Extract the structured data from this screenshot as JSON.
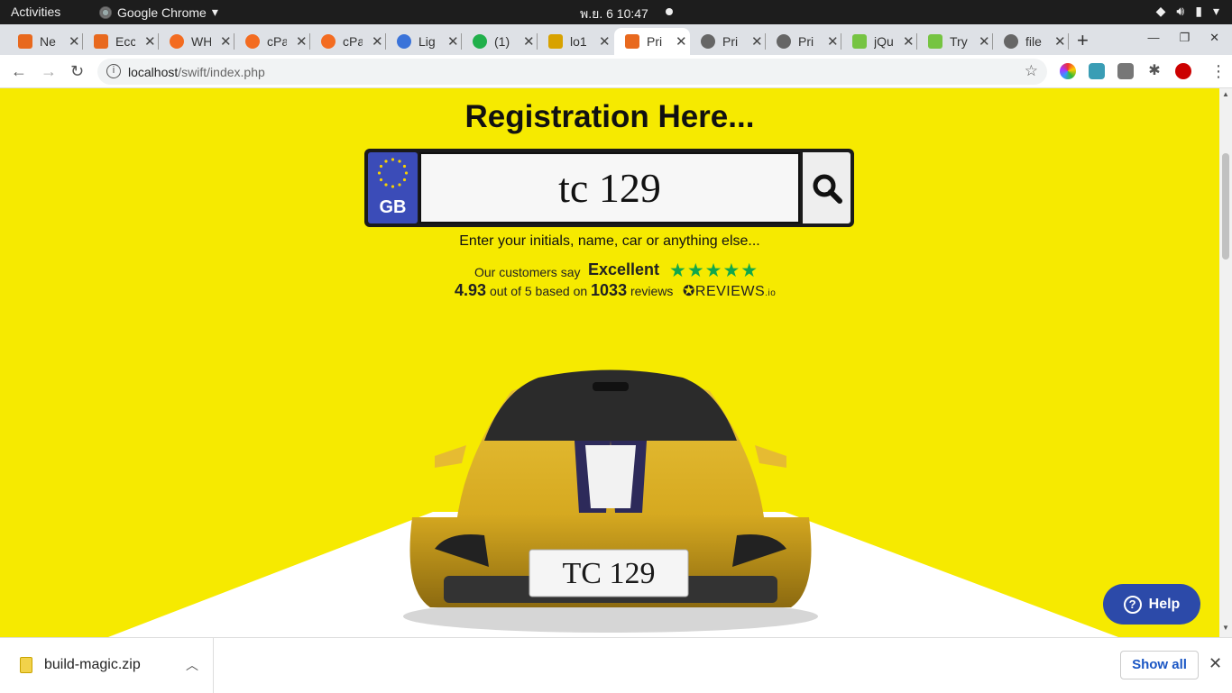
{
  "topbar": {
    "activities": "Activities",
    "app": "Google Chrome",
    "clock": "พ.ย. 6  10:47"
  },
  "tabs": [
    {
      "label": "Ne",
      "color": "#e8691e"
    },
    {
      "label": "Ecc",
      "color": "#e8691e"
    },
    {
      "label": "WH",
      "color": "#f36c21"
    },
    {
      "label": "cPa",
      "color": "#f36c21"
    },
    {
      "label": "cPa",
      "color": "#f36c21"
    },
    {
      "label": "Lig",
      "color": "#3a73d9"
    },
    {
      "label": "(1)",
      "color": "#21b04b"
    },
    {
      "label": "lo1",
      "color": "#d8a200"
    },
    {
      "label": "Pri",
      "color": "#e8691e",
      "active": true
    },
    {
      "label": "Pri",
      "color": "#666666"
    },
    {
      "label": "Pri",
      "color": "#666666"
    },
    {
      "label": "jQu",
      "color": "#76c442"
    },
    {
      "label": "Try",
      "color": "#76c442"
    },
    {
      "label": "file",
      "color": "#666666"
    }
  ],
  "address": {
    "host": "localhost",
    "path": "/swift/index.php"
  },
  "page": {
    "title": "Registration Here...",
    "plate_country": "GB",
    "plate_value": "tc 129",
    "hint": "Enter your initials, name, car or anything else...",
    "review": {
      "say": "Our customers say",
      "rating_word": "Excellent",
      "stars": "★★★★★",
      "score": "4.93",
      "out_of": "out of 5 based on",
      "count": "1033",
      "reviews_word": "reviews",
      "brand": "REVIEWS",
      "brand_suffix": ".io"
    },
    "car_plate": "TC 129",
    "help": "Help"
  },
  "downloads": {
    "file": "build-magic.zip",
    "show_all": "Show all"
  },
  "colors": {
    "page_bg": "#f6ea00",
    "gb_blue": "#3b4cb8",
    "star_green": "#11a84b",
    "help_blue": "#2c4aa9"
  }
}
